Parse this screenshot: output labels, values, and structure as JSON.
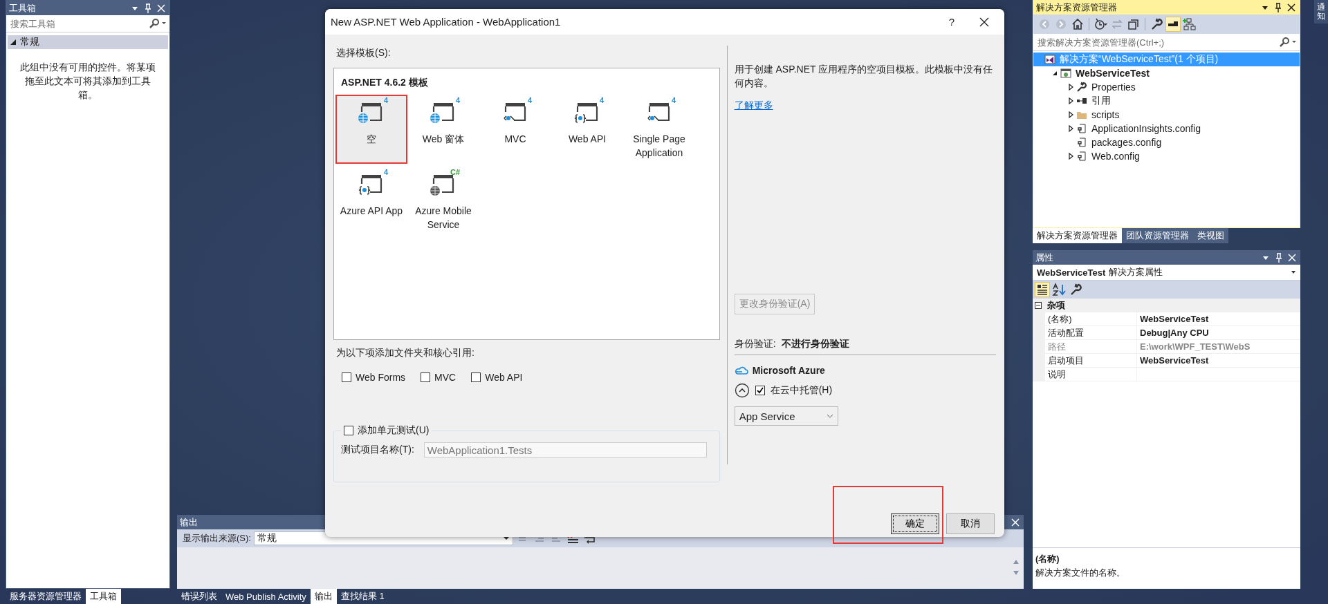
{
  "toolbox": {
    "title": "工具箱",
    "search": {
      "placeholder": "搜索工具箱"
    },
    "group": {
      "label": "常规",
      "expanded": true
    },
    "empty_text": "此组中没有可用的控件。将某项拖至此文本可将其添加到工具箱。",
    "tabs": [
      {
        "label": "服务器资源管理器",
        "selected": false
      },
      {
        "label": "工具箱",
        "selected": true
      }
    ]
  },
  "output": {
    "title": "输出",
    "source_label": "显示输出来源(S):",
    "source_value": "常规",
    "tabs": [
      {
        "label": "错误列表",
        "selected": false
      },
      {
        "label": "Web Publish Activity",
        "selected": false
      },
      {
        "label": "输出",
        "selected": true
      },
      {
        "label": "查找结果 1",
        "selected": false
      }
    ]
  },
  "dialog": {
    "title": "New ASP.NET Web Application - WebApplication1",
    "help": "?",
    "template_label": "选择模板(S):",
    "template_group": "ASP.NET 4.6.2 模板",
    "templates": [
      {
        "label": "空",
        "kind": "globe",
        "badge": "4",
        "selected": true,
        "highlighted": true
      },
      {
        "label": "Web 窗体",
        "kind": "globe",
        "badge": "4",
        "selected": false,
        "highlighted": false
      },
      {
        "label": "MVC",
        "kind": "angle",
        "badge": "4",
        "selected": false,
        "highlighted": false
      },
      {
        "label": "Web API",
        "kind": "brace",
        "badge": "4",
        "selected": false,
        "highlighted": false
      },
      {
        "label": "Single Page Application",
        "kind": "angle",
        "badge": "4",
        "selected": false,
        "highlighted": false
      },
      {
        "label": "Azure API App",
        "kind": "brace",
        "badge": "4",
        "selected": false,
        "highlighted": false
      },
      {
        "label": "Azure Mobile Service",
        "kind": "mobile",
        "badge": "C#",
        "selected": false,
        "highlighted": false
      }
    ],
    "references_label": "为以下项添加文件夹和核心引用:",
    "references": [
      {
        "label": "Web Forms",
        "checked": false
      },
      {
        "label": "MVC",
        "checked": false
      },
      {
        "label": "Web API",
        "checked": false
      }
    ],
    "unit_test": {
      "label": "添加单元测试(U)",
      "checked": false,
      "name_label": "测试项目名称(T):",
      "name_value": "WebApplication1.Tests",
      "disabled": true
    },
    "description": "用于创建 ASP.NET 应用程序的空项目模板。此模板中没有任何内容。",
    "learn_more": "了解更多",
    "change_auth_button": {
      "label": "更改身份验证(A)",
      "disabled": true
    },
    "auth_label": "身份验证:",
    "auth_value": "不进行身份验证",
    "azure_title": "Microsoft Azure",
    "azure_expanded": true,
    "host_in_cloud": {
      "label": "在云中托管(H)",
      "checked": true
    },
    "service_type": "App Service",
    "buttons": [
      {
        "label": "确定",
        "default": true,
        "highlighted": true
      },
      {
        "label": "取消",
        "default": false,
        "highlighted": false
      }
    ]
  },
  "solution_explorer": {
    "title": "解决方案资源管理器",
    "search": {
      "placeholder": "搜索解决方案资源管理器(Ctrl+;)"
    },
    "tree": [
      {
        "label": "解决方案“WebServiceTest”(1 个项目)",
        "kind": "solution",
        "selected": true,
        "startup": false,
        "expandable": false,
        "children": [
          {
            "label": "WebServiceTest",
            "kind": "project",
            "selected": false,
            "startup": true,
            "expandable": true,
            "expanded": true,
            "children": [
              {
                "label": "Properties",
                "kind": "wrench",
                "selected": false,
                "startup": false,
                "expandable": true,
                "expanded": false
              },
              {
                "label": "引用",
                "kind": "reference",
                "selected": false,
                "startup": false,
                "expandable": true,
                "expanded": false
              },
              {
                "label": "scripts",
                "kind": "folder",
                "selected": false,
                "startup": false,
                "expandable": true,
                "expanded": false
              },
              {
                "label": "ApplicationInsights.config",
                "kind": "config",
                "selected": false,
                "startup": false,
                "expandable": true,
                "expanded": false
              },
              {
                "label": "packages.config",
                "kind": "config",
                "selected": false,
                "startup": false,
                "expandable": false
              },
              {
                "label": "Web.config",
                "kind": "config",
                "selected": false,
                "startup": false,
                "expandable": true,
                "expanded": false
              }
            ]
          }
        ]
      }
    ],
    "tabs": [
      {
        "label": "解决方案资源管理器",
        "selected": true
      },
      {
        "label": "团队资源管理器",
        "selected": false
      },
      {
        "label": "类视图",
        "selected": false
      }
    ]
  },
  "properties": {
    "title": "属性",
    "object": "WebServiceTest",
    "object_type": "解决方案属性",
    "categories": [
      {
        "label": "杂项",
        "expanded": true,
        "rows": [
          {
            "name": "(名称)",
            "value": "WebServiceTest",
            "disabled": false
          },
          {
            "name": "活动配置",
            "value": "Debug|Any CPU",
            "disabled": false
          },
          {
            "name": "路径",
            "value": "E:\\work\\WPF_TEST\\WebS",
            "disabled": true
          },
          {
            "name": "启动项目",
            "value": "WebServiceTest",
            "disabled": false
          },
          {
            "name": "说明",
            "disabled": false
          }
        ]
      }
    ],
    "description_title": "(名称)",
    "description": "解决方案文件的名称。"
  },
  "notifications_tab": {
    "label": "通知"
  }
}
